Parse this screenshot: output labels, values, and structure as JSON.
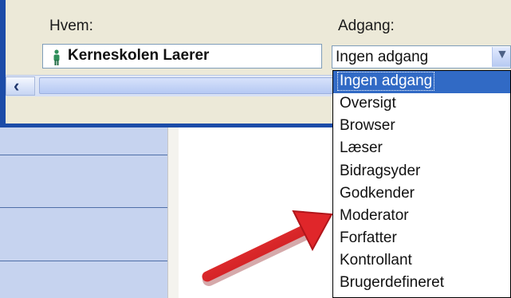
{
  "labels": {
    "who": "Hvem:",
    "access": "Adgang:"
  },
  "name_field": {
    "value": "Kerneskolen Laerer"
  },
  "access_select": {
    "value": "Ingen adgang"
  },
  "dropdown": {
    "options": [
      "Ingen adgang",
      "Oversigt",
      "Browser",
      "Læser",
      "Bidragsyder",
      "Godkender",
      "Moderator",
      "Forfatter",
      "Kontrollant",
      "Brugerdefineret"
    ],
    "selected": "Ingen adgang"
  },
  "colors": {
    "selection": "#316ac5",
    "frame_blue": "#1c4ca8",
    "arrow_red": "#e0262a",
    "person_green": "#2f8f5a"
  },
  "icons": {
    "person": "person-icon",
    "dropdown": "chevron-down-icon",
    "scroll_left": "chevron-left-icon",
    "annotation": "red-arrow-icon"
  }
}
